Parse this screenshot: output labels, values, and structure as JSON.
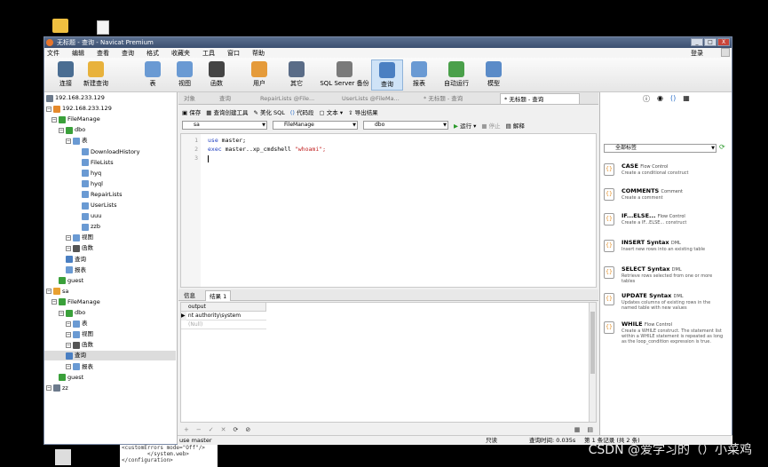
{
  "window": {
    "title": "无标题 - 查询 - Navicat Premium"
  },
  "window_buttons": [
    "_",
    "□",
    "X"
  ],
  "menu": [
    "文件",
    "编辑",
    "查看",
    "查询",
    "格式",
    "收藏夹",
    "工具",
    "窗口",
    "帮助"
  ],
  "login_label": "登录",
  "toolbar": [
    {
      "label": "连接",
      "icon": "connect-icon",
      "color": "#4a6d92"
    },
    {
      "label": "新建查询",
      "icon": "new-query-icon",
      "color": "#e8b23c"
    },
    {
      "label": "表",
      "icon": "table-icon",
      "color": "#6a9ad3"
    },
    {
      "label": "视图",
      "icon": "view-icon",
      "color": "#6a9ad3"
    },
    {
      "label": "函数",
      "icon": "function-icon",
      "color": "#444444"
    },
    {
      "label": "用户",
      "icon": "user-icon",
      "color": "#e59b3a"
    },
    {
      "label": "其它",
      "icon": "tools-icon",
      "color": "#5a6c87"
    },
    {
      "label": "SQL Server 备份",
      "icon": "backup-icon",
      "color": "#7a7a7a"
    },
    {
      "label": "查询",
      "icon": "query-icon",
      "color": "#4a7fc2"
    },
    {
      "label": "报表",
      "icon": "report-icon",
      "color": "#6a9ad3"
    },
    {
      "label": "自动运行",
      "icon": "schedule-icon",
      "color": "#4aa04a"
    },
    {
      "label": "模型",
      "icon": "model-icon",
      "color": "#5a8bc8"
    }
  ],
  "tree": [
    {
      "label": "192.168.233.129",
      "icon": "server-icon",
      "color": "#6c7a8c"
    },
    {
      "label": "192.168.233.129",
      "icon": "server-icon",
      "color": "#e58a2c"
    },
    {
      "label": "FileManage",
      "icon": "database-icon",
      "color": "#3aa03a"
    },
    {
      "label": "dbo",
      "icon": "schema-icon",
      "color": "#3aa03a"
    },
    {
      "label": "表",
      "icon": "tables-icon",
      "color": "#6a9ad3"
    },
    {
      "label": "DownloadHistory",
      "icon": "table-icon",
      "color": "#6a9ad3"
    },
    {
      "label": "FileLists",
      "icon": "table-icon",
      "color": "#6a9ad3"
    },
    {
      "label": "hyq",
      "icon": "table-icon",
      "color": "#6a9ad3"
    },
    {
      "label": "hyql",
      "icon": "table-icon",
      "color": "#6a9ad3"
    },
    {
      "label": "RepairLists",
      "icon": "table-icon",
      "color": "#6a9ad3"
    },
    {
      "label": "UserLists",
      "icon": "table-icon",
      "color": "#6a9ad3"
    },
    {
      "label": "uuu",
      "icon": "table-icon",
      "color": "#6a9ad3"
    },
    {
      "label": "zzb",
      "icon": "table-icon",
      "color": "#6a9ad3"
    },
    {
      "label": "视图",
      "icon": "views-icon",
      "color": "#6a9ad3"
    },
    {
      "label": "函数",
      "icon": "functions-icon",
      "color": "#555555"
    },
    {
      "label": "查询",
      "icon": "queries-icon",
      "color": "#4a7fc2"
    },
    {
      "label": "报表",
      "icon": "reports-icon",
      "color": "#6a9ad3"
    },
    {
      "label": "guest",
      "icon": "schema-icon",
      "color": "#3aa03a"
    },
    {
      "label": "sa",
      "icon": "user-icon",
      "color": "#e8a030"
    },
    {
      "label": "FileManage",
      "icon": "database-icon",
      "color": "#3aa03a"
    },
    {
      "label": "dbo",
      "icon": "schema-icon",
      "color": "#3aa03a"
    },
    {
      "label": "表",
      "icon": "tables-icon",
      "color": "#6a9ad3"
    },
    {
      "label": "视图",
      "icon": "views-icon",
      "color": "#6a9ad3"
    },
    {
      "label": "函数",
      "icon": "functions-icon",
      "color": "#555555"
    },
    {
      "label": "查询",
      "icon": "queries-icon",
      "color": "#4a7fc2"
    },
    {
      "label": "报表",
      "icon": "reports-icon",
      "color": "#6a9ad3"
    },
    {
      "label": "guest",
      "icon": "schema-icon",
      "color": "#3aa03a"
    },
    {
      "label": "zz",
      "icon": "server-icon",
      "color": "#6c7a8c"
    }
  ],
  "tabs": [
    "对象",
    "查询",
    "RepairLists @File...",
    "UserLists @FileMa...",
    "* 无标题 - 查询",
    "* 无标题 - 查询"
  ],
  "query_toolbar": {
    "save": "保存",
    "builder": "查询创建工具",
    "beautify": "美化 SQL",
    "snippet": "代码段",
    "text": "文本",
    "export": "导出结果"
  },
  "selectors": {
    "connection": "sa",
    "database": "FileManage",
    "schema": "dbo",
    "run": "运行",
    "stop": "停止",
    "explain": "解释"
  },
  "code_lines": [
    {
      "num": "1",
      "kw": "use",
      "rest": " master;",
      "str": ""
    },
    {
      "num": "2",
      "kw": "exec",
      "rest": " master..xp_cmdshell ",
      "str": "\"whoami\";"
    },
    {
      "num": "3",
      "kw": "",
      "rest": "",
      "str": ""
    }
  ],
  "result_tabs": [
    "信息",
    "结果 1"
  ],
  "grid": {
    "column": "output",
    "rows": [
      "nt authority\\system",
      "(Null)"
    ]
  },
  "status": {
    "sql": "use master",
    "readonly": "只读",
    "time": "查询时间: 0.035s",
    "record": "第 1 条记录 (共 2 条)"
  },
  "right_panel": {
    "dropdown": "全部标签",
    "snippets": [
      {
        "title": "CASE",
        "tag": "Flow Control",
        "desc": "Create a conditional construct"
      },
      {
        "title": "COMMENTS",
        "tag": "Comment",
        "desc": "Create a comment"
      },
      {
        "title": "IF...ELSE...",
        "tag": "Flow Control",
        "desc": "Create a IF...ELSE... construct"
      },
      {
        "title": "INSERT Syntax",
        "tag": "DML",
        "desc": "Insert new rows into an existing table"
      },
      {
        "title": "SELECT Syntax",
        "tag": "DML",
        "desc": "Retrieve rows selected from one or more tables"
      },
      {
        "title": "UPDATE Syntax",
        "tag": "DML",
        "desc": "Updates columns of existing rows in the named table with new values"
      },
      {
        "title": "WHILE",
        "tag": "Flow Control",
        "desc": "Create a WHILE construct. The statement list within a WHILE statement is repeated as long as the loop_condition expression is true."
      }
    ]
  },
  "below_text": [
    "<customErrors mode=\"Off\"/>",
    "        </system.web>",
    "</configuration>"
  ],
  "watermark": "CSDN @爱学习的（）小菜鸡"
}
